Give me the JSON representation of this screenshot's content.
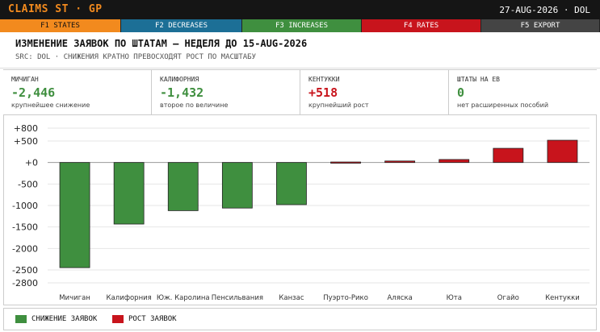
{
  "app": {
    "title": "CLAIMS ST · GP",
    "date_text": "27-AUG-2026 · DOL"
  },
  "tabs": [
    {
      "label": "F1 STATES",
      "color": "#f28a1e"
    },
    {
      "label": "F2 DECREASES",
      "color": "#1c6f96"
    },
    {
      "label": "F3 INCREASES",
      "color": "#3f8f3f"
    },
    {
      "label": "F4 RATES",
      "color": "#c8141c"
    },
    {
      "label": "F5 EXPORT",
      "color": "#444444"
    }
  ],
  "header": {
    "title": "ИЗМЕНЕНИЕ ЗАЯВОК ПО ШТАТАМ — НЕДЕЛЯ ДО 15-AUG-2026",
    "subtitle": "SRC: DOL · СНИЖЕНИЯ КРАТНО ПРЕВОСХОДЯТ РОСТ ПО МАСШТАБУ"
  },
  "stats": [
    {
      "label": "МИЧИГАН",
      "value": "-2,446",
      "sub": "крупнейшее снижение",
      "color": "#3f8f3f"
    },
    {
      "label": "КАЛИФОРНИЯ",
      "value": "-1,432",
      "sub": "второе по величине",
      "color": "#3f8f3f"
    },
    {
      "label": "КЕНТУККИ",
      "value": "+518",
      "sub": "крупнейший рост",
      "color": "#c8141c"
    },
    {
      "label": "ШТАТЫ НА ЕВ",
      "value": "0",
      "sub": "нет расширенных пособий",
      "color": "#3f8f3f"
    }
  ],
  "legend": {
    "decrease": "СНИЖЕНИЕ ЗАЯВОК",
    "increase": "РОСТ ЗАЯВОК"
  },
  "colors": {
    "decrease": "#3f8f3f",
    "increase": "#c8141c"
  },
  "chart_data": {
    "type": "bar",
    "categories": [
      "Мичиган",
      "Калифорния",
      "Юж. Каролина",
      "Пенсильвания",
      "Канзас",
      "Пуэрто-Рико",
      "Аляска",
      "Юта",
      "Огайо",
      "Кентукки"
    ],
    "values": [
      -2446,
      -1432,
      -1120,
      -1060,
      -980,
      12,
      35,
      70,
      330,
      518
    ],
    "ylim": [
      -2800,
      800
    ],
    "yticks": [
      {
        "v": 800,
        "t": "+800"
      },
      {
        "v": 500,
        "t": "+500"
      },
      {
        "v": 0,
        "t": "+0"
      },
      {
        "v": -500,
        "t": "-500"
      },
      {
        "v": -1000,
        "t": "-1000"
      },
      {
        "v": -1500,
        "t": "-1500"
      },
      {
        "v": -2000,
        "t": "-2000"
      },
      {
        "v": -2500,
        "t": "-2500"
      },
      {
        "v": -2800,
        "t": "-2800"
      }
    ],
    "grid": true
  }
}
